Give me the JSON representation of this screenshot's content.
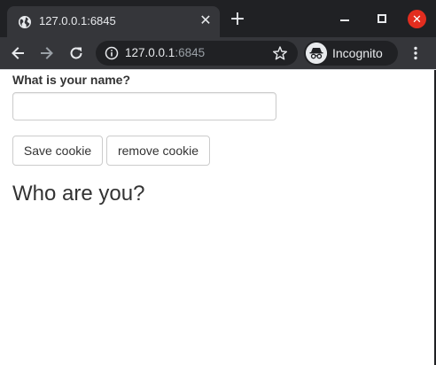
{
  "browser": {
    "tab_title": "127.0.0.1:6845",
    "address_host": "127.0.0.1",
    "address_port": ":6845",
    "profile_label": "Incognito",
    "icons": {
      "favicon": "globe-icon",
      "tab_close": "close-icon",
      "new_tab": "plus-icon",
      "back": "arrow-left-icon",
      "forward": "arrow-right-icon",
      "reload": "reload-icon",
      "site_info": "info-icon",
      "bookmark": "star-icon",
      "incognito": "incognito-icon",
      "menu": "more-vert-icon",
      "minimize": "minimize-icon",
      "maximize": "maximize-icon",
      "close_window": "close-icon"
    },
    "colors": {
      "tabstrip": "#202124",
      "toolbar": "#35363a",
      "window_close": "#e22d1f"
    }
  },
  "page": {
    "name_label": "What is your name?",
    "name_value": "",
    "save_button": "Save cookie",
    "remove_button": "remove cookie",
    "greeting": "Who are you?"
  }
}
